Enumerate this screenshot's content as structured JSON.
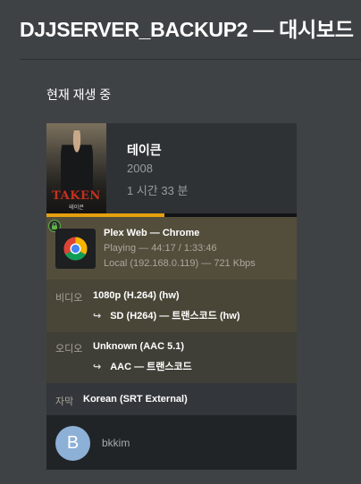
{
  "header": {
    "title": "DJJSERVER_BACKUP2 — 대시보드"
  },
  "now_playing": {
    "section_title": "현재 재생 중"
  },
  "media": {
    "poster_title": "TAKEN",
    "poster_subtitle": "테이큰",
    "title": "테이큰",
    "year": "2008",
    "duration": "1 시간 33 분",
    "progress_fraction": 0.47
  },
  "player": {
    "line1": "Plex Web  —  Chrome",
    "line2": "Playing — 44:17 / 1:33:46",
    "line3": "Local (192.168.0.119) — 721 Kbps",
    "icon": "chrome-icon",
    "secure_icon": "lock-icon",
    "secure_color": "#5fb346"
  },
  "video": {
    "label": "비디오",
    "value": "1080p (H.264) (hw)",
    "arrow": "↪",
    "transcode": "SD (H264) — 트랜스코드 (hw)"
  },
  "audio": {
    "label": "오디오",
    "value": "Unknown (AAC 5.1)",
    "arrow": "↪",
    "transcode": "AAC — 트랜스코드"
  },
  "subtitle": {
    "label": "자막",
    "value": "Korean (SRT External)"
  },
  "user": {
    "initial": "B",
    "name": "bkkim",
    "avatar_color": "#8db0d6"
  },
  "colors": {
    "accent": "#e5a00d",
    "background": "#3f4245"
  }
}
